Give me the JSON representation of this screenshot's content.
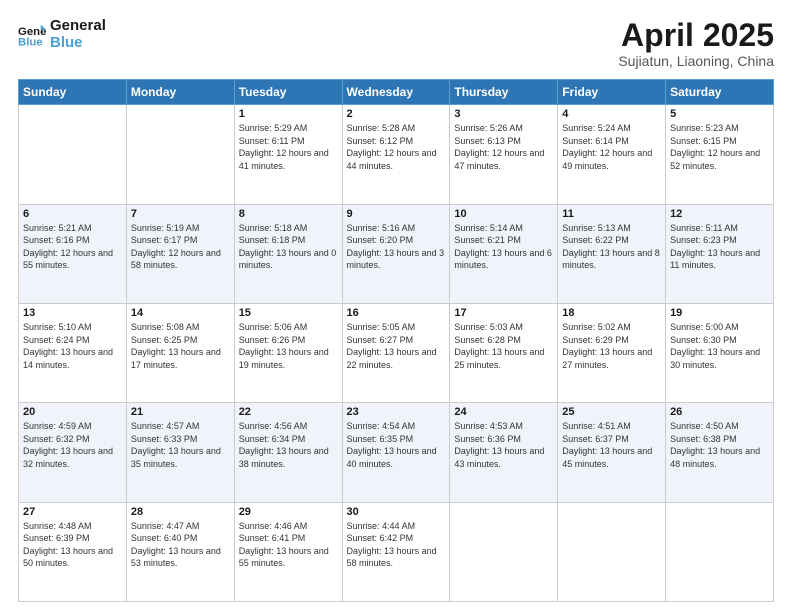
{
  "header": {
    "logo_line1": "General",
    "logo_line2": "Blue",
    "title": "April 2025",
    "subtitle": "Sujiatun, Liaoning, China"
  },
  "calendar": {
    "days_of_week": [
      "Sunday",
      "Monday",
      "Tuesday",
      "Wednesday",
      "Thursday",
      "Friday",
      "Saturday"
    ],
    "weeks": [
      [
        {
          "day": "",
          "sunrise": "",
          "sunset": "",
          "daylight": ""
        },
        {
          "day": "",
          "sunrise": "",
          "sunset": "",
          "daylight": ""
        },
        {
          "day": "1",
          "sunrise": "Sunrise: 5:29 AM",
          "sunset": "Sunset: 6:11 PM",
          "daylight": "Daylight: 12 hours and 41 minutes."
        },
        {
          "day": "2",
          "sunrise": "Sunrise: 5:28 AM",
          "sunset": "Sunset: 6:12 PM",
          "daylight": "Daylight: 12 hours and 44 minutes."
        },
        {
          "day": "3",
          "sunrise": "Sunrise: 5:26 AM",
          "sunset": "Sunset: 6:13 PM",
          "daylight": "Daylight: 12 hours and 47 minutes."
        },
        {
          "day": "4",
          "sunrise": "Sunrise: 5:24 AM",
          "sunset": "Sunset: 6:14 PM",
          "daylight": "Daylight: 12 hours and 49 minutes."
        },
        {
          "day": "5",
          "sunrise": "Sunrise: 5:23 AM",
          "sunset": "Sunset: 6:15 PM",
          "daylight": "Daylight: 12 hours and 52 minutes."
        }
      ],
      [
        {
          "day": "6",
          "sunrise": "Sunrise: 5:21 AM",
          "sunset": "Sunset: 6:16 PM",
          "daylight": "Daylight: 12 hours and 55 minutes."
        },
        {
          "day": "7",
          "sunrise": "Sunrise: 5:19 AM",
          "sunset": "Sunset: 6:17 PM",
          "daylight": "Daylight: 12 hours and 58 minutes."
        },
        {
          "day": "8",
          "sunrise": "Sunrise: 5:18 AM",
          "sunset": "Sunset: 6:18 PM",
          "daylight": "Daylight: 13 hours and 0 minutes."
        },
        {
          "day": "9",
          "sunrise": "Sunrise: 5:16 AM",
          "sunset": "Sunset: 6:20 PM",
          "daylight": "Daylight: 13 hours and 3 minutes."
        },
        {
          "day": "10",
          "sunrise": "Sunrise: 5:14 AM",
          "sunset": "Sunset: 6:21 PM",
          "daylight": "Daylight: 13 hours and 6 minutes."
        },
        {
          "day": "11",
          "sunrise": "Sunrise: 5:13 AM",
          "sunset": "Sunset: 6:22 PM",
          "daylight": "Daylight: 13 hours and 8 minutes."
        },
        {
          "day": "12",
          "sunrise": "Sunrise: 5:11 AM",
          "sunset": "Sunset: 6:23 PM",
          "daylight": "Daylight: 13 hours and 11 minutes."
        }
      ],
      [
        {
          "day": "13",
          "sunrise": "Sunrise: 5:10 AM",
          "sunset": "Sunset: 6:24 PM",
          "daylight": "Daylight: 13 hours and 14 minutes."
        },
        {
          "day": "14",
          "sunrise": "Sunrise: 5:08 AM",
          "sunset": "Sunset: 6:25 PM",
          "daylight": "Daylight: 13 hours and 17 minutes."
        },
        {
          "day": "15",
          "sunrise": "Sunrise: 5:06 AM",
          "sunset": "Sunset: 6:26 PM",
          "daylight": "Daylight: 13 hours and 19 minutes."
        },
        {
          "day": "16",
          "sunrise": "Sunrise: 5:05 AM",
          "sunset": "Sunset: 6:27 PM",
          "daylight": "Daylight: 13 hours and 22 minutes."
        },
        {
          "day": "17",
          "sunrise": "Sunrise: 5:03 AM",
          "sunset": "Sunset: 6:28 PM",
          "daylight": "Daylight: 13 hours and 25 minutes."
        },
        {
          "day": "18",
          "sunrise": "Sunrise: 5:02 AM",
          "sunset": "Sunset: 6:29 PM",
          "daylight": "Daylight: 13 hours and 27 minutes."
        },
        {
          "day": "19",
          "sunrise": "Sunrise: 5:00 AM",
          "sunset": "Sunset: 6:30 PM",
          "daylight": "Daylight: 13 hours and 30 minutes."
        }
      ],
      [
        {
          "day": "20",
          "sunrise": "Sunrise: 4:59 AM",
          "sunset": "Sunset: 6:32 PM",
          "daylight": "Daylight: 13 hours and 32 minutes."
        },
        {
          "day": "21",
          "sunrise": "Sunrise: 4:57 AM",
          "sunset": "Sunset: 6:33 PM",
          "daylight": "Daylight: 13 hours and 35 minutes."
        },
        {
          "day": "22",
          "sunrise": "Sunrise: 4:56 AM",
          "sunset": "Sunset: 6:34 PM",
          "daylight": "Daylight: 13 hours and 38 minutes."
        },
        {
          "day": "23",
          "sunrise": "Sunrise: 4:54 AM",
          "sunset": "Sunset: 6:35 PM",
          "daylight": "Daylight: 13 hours and 40 minutes."
        },
        {
          "day": "24",
          "sunrise": "Sunrise: 4:53 AM",
          "sunset": "Sunset: 6:36 PM",
          "daylight": "Daylight: 13 hours and 43 minutes."
        },
        {
          "day": "25",
          "sunrise": "Sunrise: 4:51 AM",
          "sunset": "Sunset: 6:37 PM",
          "daylight": "Daylight: 13 hours and 45 minutes."
        },
        {
          "day": "26",
          "sunrise": "Sunrise: 4:50 AM",
          "sunset": "Sunset: 6:38 PM",
          "daylight": "Daylight: 13 hours and 48 minutes."
        }
      ],
      [
        {
          "day": "27",
          "sunrise": "Sunrise: 4:48 AM",
          "sunset": "Sunset: 6:39 PM",
          "daylight": "Daylight: 13 hours and 50 minutes."
        },
        {
          "day": "28",
          "sunrise": "Sunrise: 4:47 AM",
          "sunset": "Sunset: 6:40 PM",
          "daylight": "Daylight: 13 hours and 53 minutes."
        },
        {
          "day": "29",
          "sunrise": "Sunrise: 4:46 AM",
          "sunset": "Sunset: 6:41 PM",
          "daylight": "Daylight: 13 hours and 55 minutes."
        },
        {
          "day": "30",
          "sunrise": "Sunrise: 4:44 AM",
          "sunset": "Sunset: 6:42 PM",
          "daylight": "Daylight: 13 hours and 58 minutes."
        },
        {
          "day": "",
          "sunrise": "",
          "sunset": "",
          "daylight": ""
        },
        {
          "day": "",
          "sunrise": "",
          "sunset": "",
          "daylight": ""
        },
        {
          "day": "",
          "sunrise": "",
          "sunset": "",
          "daylight": ""
        }
      ]
    ]
  }
}
